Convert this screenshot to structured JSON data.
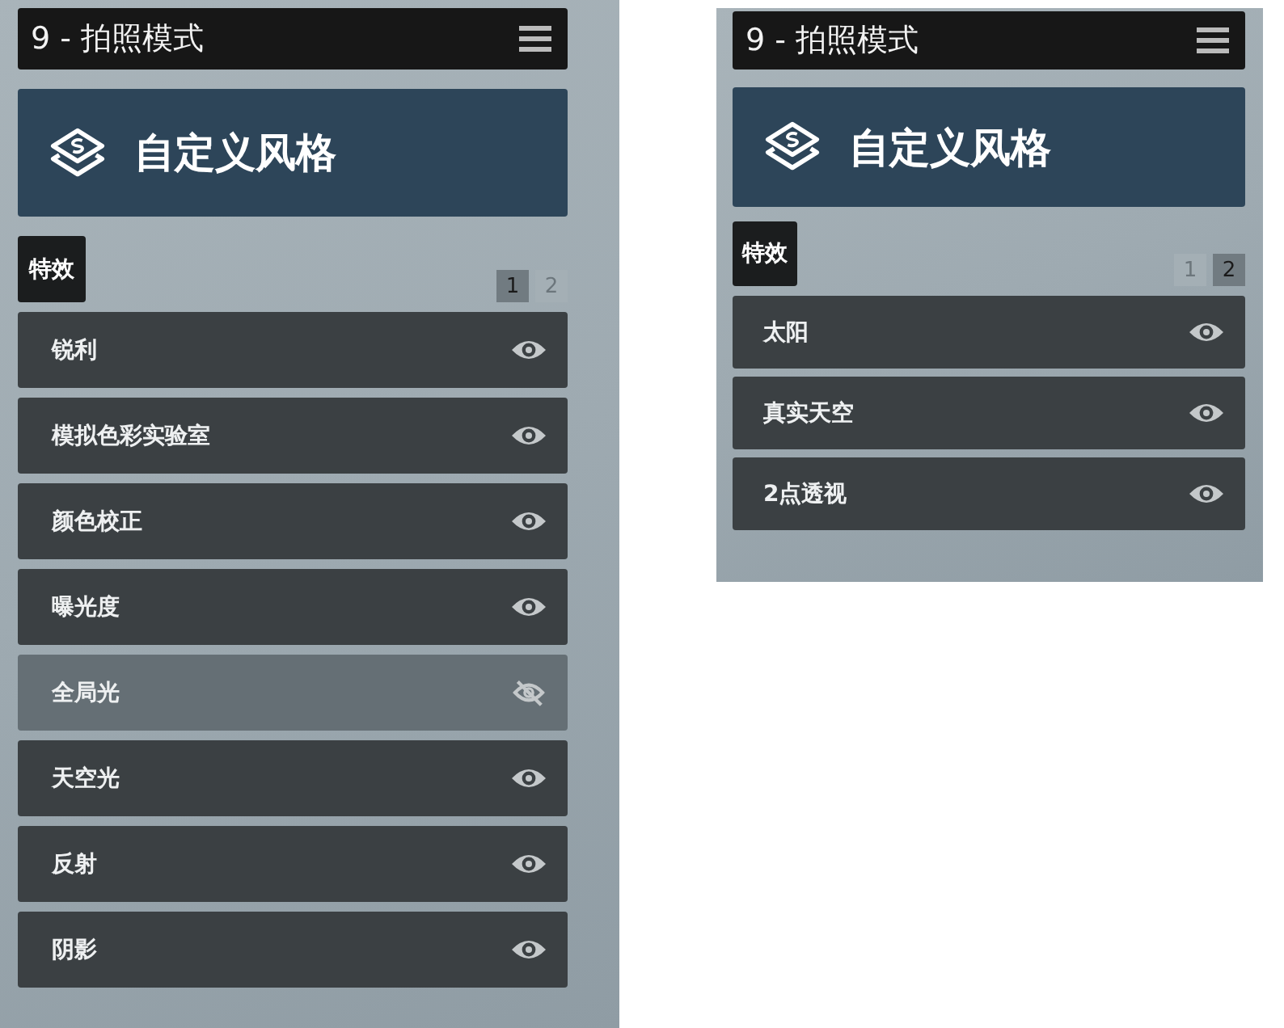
{
  "panels": [
    {
      "title": "9 - 拍照模式",
      "banner": "自定义风格",
      "section_tab": "特效",
      "pages": [
        {
          "label": "1",
          "selected": true
        },
        {
          "label": "2",
          "selected": false
        }
      ],
      "items": [
        {
          "label": "锐利",
          "visible": true
        },
        {
          "label": "模拟色彩实验室",
          "visible": true
        },
        {
          "label": "颜色校正",
          "visible": true
        },
        {
          "label": "曝光度",
          "visible": true
        },
        {
          "label": "全局光",
          "visible": false
        },
        {
          "label": "天空光",
          "visible": true
        },
        {
          "label": "反射",
          "visible": true
        },
        {
          "label": "阴影",
          "visible": true
        }
      ]
    },
    {
      "title": "9 - 拍照模式",
      "banner": "自定义风格",
      "section_tab": "特效",
      "pages": [
        {
          "label": "1",
          "selected": false
        },
        {
          "label": "2",
          "selected": true
        }
      ],
      "items": [
        {
          "label": "太阳",
          "visible": true
        },
        {
          "label": "真实天空",
          "visible": true
        },
        {
          "label": "2点透视",
          "visible": true
        }
      ]
    }
  ]
}
